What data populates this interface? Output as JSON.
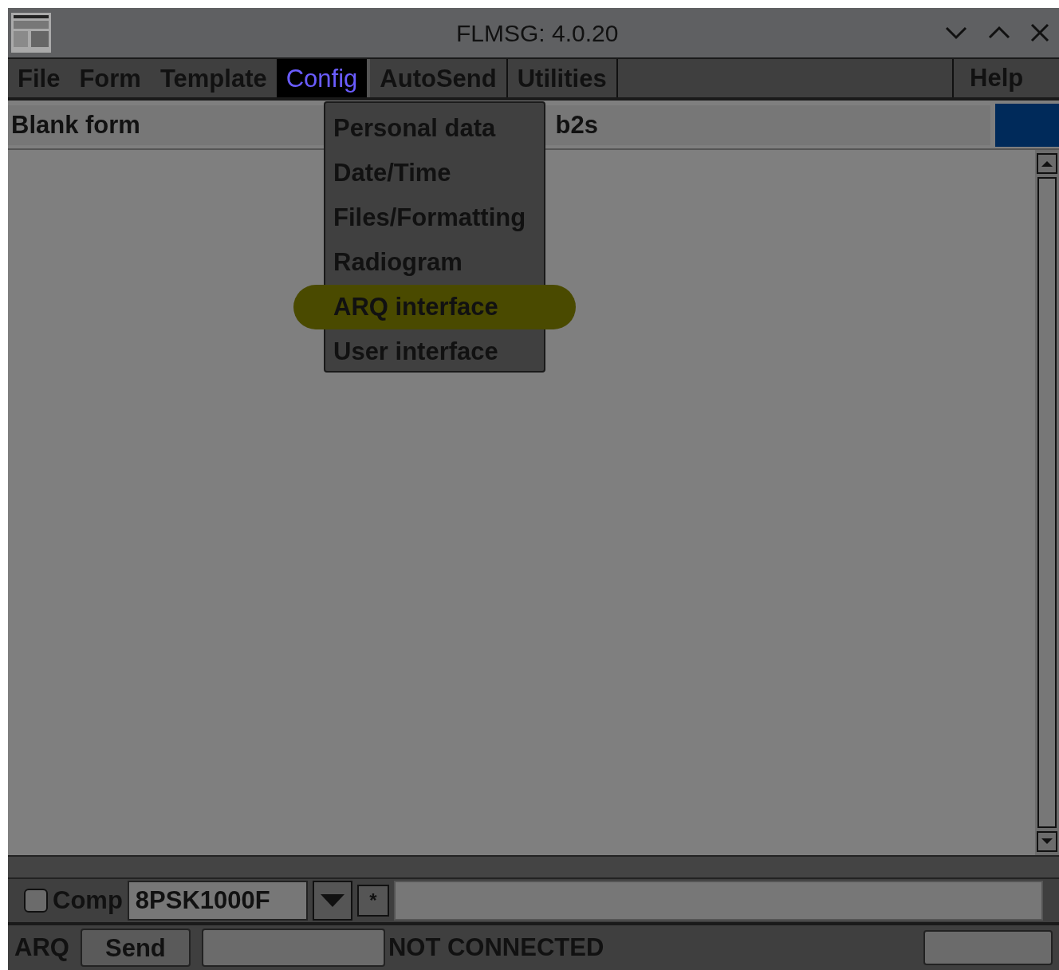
{
  "window": {
    "title": "FLMSG: 4.0.20"
  },
  "menu_bar": [
    {
      "label": "File",
      "selected": false
    },
    {
      "label": "Form",
      "selected": false
    },
    {
      "label": "Template",
      "selected": false
    },
    {
      "label": "Config",
      "selected": true
    },
    {
      "label": "AutoSend",
      "selected": false
    },
    {
      "label": "Utilities",
      "selected": false
    }
  ],
  "help_menu": {
    "label": "Help"
  },
  "config_menu": [
    {
      "label": "Personal data",
      "highlighted": false
    },
    {
      "label": "Date/Time",
      "highlighted": false
    },
    {
      "label": "Files/Formatting",
      "highlighted": false
    },
    {
      "label": "Radiogram",
      "highlighted": false
    },
    {
      "label": "ARQ interface",
      "highlighted": true
    },
    {
      "label": "User interface",
      "highlighted": false
    }
  ],
  "form_type": "Blank form",
  "file_name": "b2s",
  "compress": {
    "label": "Comp",
    "checked": false
  },
  "mode": "8PSK1000F",
  "mode_button": "*",
  "arq": {
    "label": "ARQ",
    "send": "Send",
    "status": "NOT CONNECTED"
  }
}
